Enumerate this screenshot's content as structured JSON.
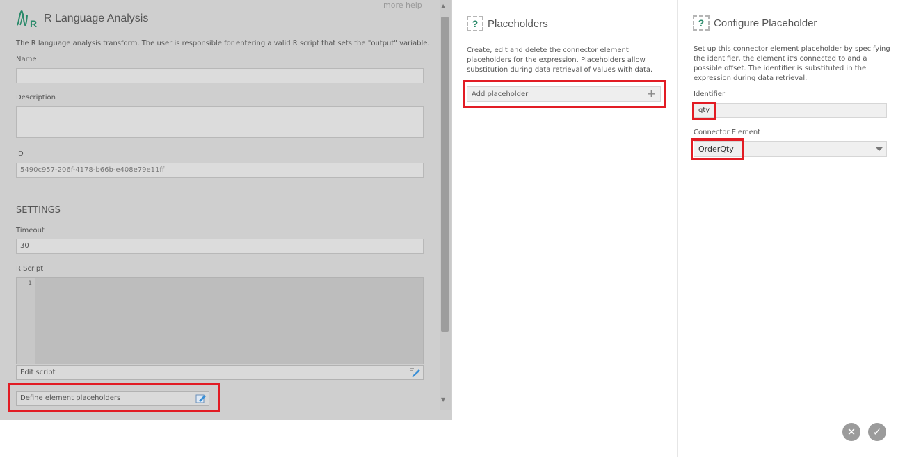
{
  "left_panel": {
    "more_help": "more help",
    "title": "R Language Analysis",
    "logo_letter": "R",
    "description": "The R language analysis transform. The user is responsible for entering a valid R script that sets the \"output\" variable.",
    "name_label": "Name",
    "name_value": "",
    "description_label": "Description",
    "description_value": "",
    "id_label": "ID",
    "id_value": "5490c957-206f-4178-b66b-e408e79e11ff",
    "settings_heading": "SETTINGS",
    "timeout_label": "Timeout",
    "timeout_value": "30",
    "rscript_label": "R Script",
    "line_number": "1",
    "edit_script_label": "Edit script",
    "define_placeholders_label": "Define element placeholders"
  },
  "middle_panel": {
    "help_icon": "?",
    "title": "Placeholders",
    "description": "Create, edit and delete the connector element placeholders for the expression. Placeholders allow substitution during data retrieval of values with data.",
    "add_placeholder_label": "Add placeholder",
    "add_icon": "+"
  },
  "right_panel": {
    "help_icon": "?",
    "title": "Configure Placeholder",
    "description": "Set up this connector element placeholder by specifying the identifier, the element it's connected to and a possible offset. The identifier is substituted in the expression during data retrieval.",
    "identifier_label": "Identifier",
    "identifier_value": "qty",
    "connector_element_label": "Connector Element",
    "connector_element_value": "OrderQty",
    "cancel_icon": "✕",
    "confirm_icon": "✓"
  },
  "colors": {
    "highlight": "#e21c24",
    "overlay": "#cfcfcf",
    "accent": "#2a8a6a"
  }
}
